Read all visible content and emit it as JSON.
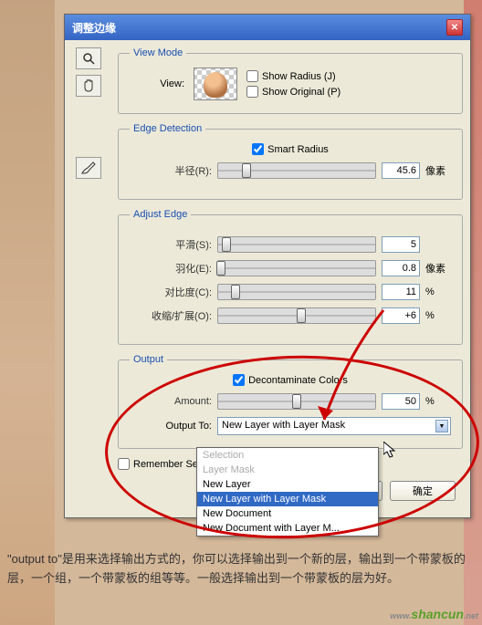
{
  "dialog": {
    "title": "调整边缘"
  },
  "viewmode": {
    "legend": "View Mode",
    "view_label": "View:",
    "show_radius": "Show Radius (J)",
    "show_original": "Show Original (P)"
  },
  "edge": {
    "legend": "Edge Detection",
    "smart_radius": "Smart Radius",
    "radius_label": "半径(R):",
    "radius_value": "45.6",
    "radius_unit": "像素"
  },
  "adjust": {
    "legend": "Adjust Edge",
    "smooth_label": "平滑(S):",
    "smooth_value": "5",
    "feather_label": "羽化(E):",
    "feather_value": "0.8",
    "feather_unit": "像素",
    "contrast_label": "对比度(C):",
    "contrast_value": "11",
    "contrast_unit": "%",
    "shift_label": "收缩/扩展(O):",
    "shift_value": "+6",
    "shift_unit": "%"
  },
  "output": {
    "legend": "Output",
    "decontaminate": "Decontaminate Colors",
    "amount_label": "Amount:",
    "amount_value": "50",
    "amount_unit": "%",
    "output_to_label": "Output To:",
    "selected": "New Layer with Layer Mask",
    "options": {
      "0": "Selection",
      "1": "Layer Mask",
      "2": "New Layer",
      "3": "New Layer with Layer Mask",
      "4": "New Document",
      "5": "New Document with Layer M..."
    }
  },
  "remember": "Remember Set",
  "buttons": {
    "ok": "确定"
  },
  "caption": "\"output to\"是用来选择输出方式的，你可以选择输出到一个新的层，输出到一个带蒙板的层，一个组，一个带蒙板的组等等。一般选择输出到一个带蒙板的层为好。",
  "watermark": "shancun"
}
